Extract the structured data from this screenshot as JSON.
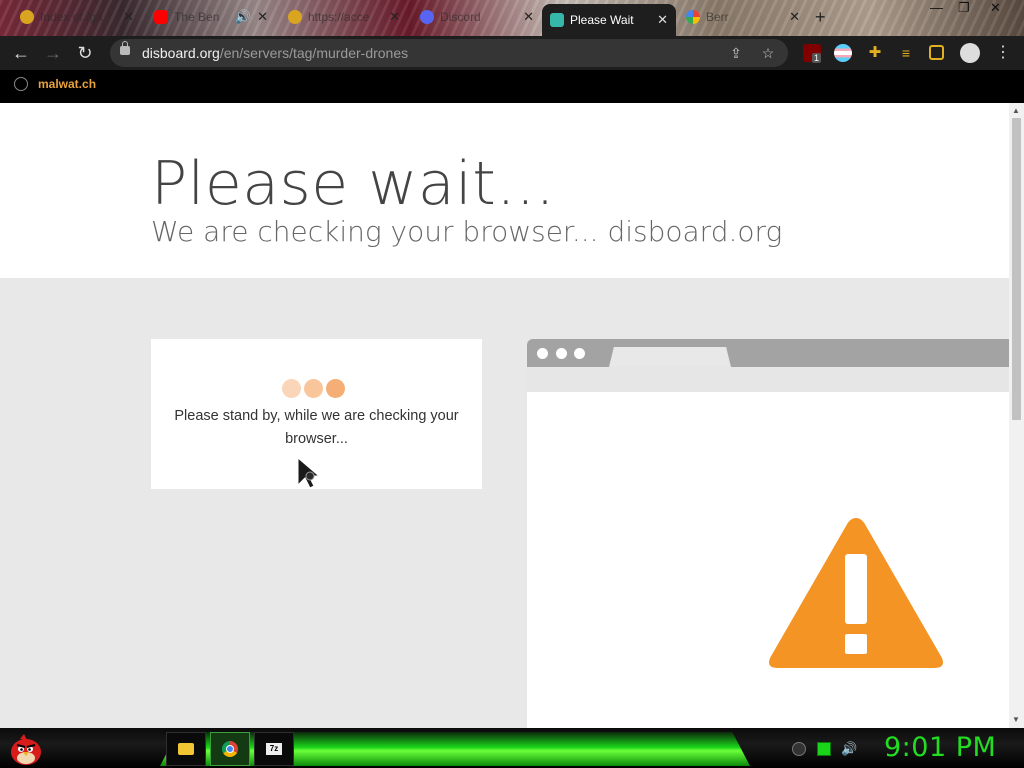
{
  "tabs": [
    {
      "title": "Index of /ga",
      "active": false,
      "favicon": "gold-coin-icon"
    },
    {
      "title": "The Ben",
      "active": false,
      "favicon": "youtube-icon"
    },
    {
      "title": "https://acce",
      "active": false,
      "favicon": "gold-coin-icon"
    },
    {
      "title": "Discord",
      "active": false,
      "favicon": "discord-icon"
    },
    {
      "title": "Please Wait",
      "active": true,
      "favicon": "disboard-icon"
    },
    {
      "title": "Berr",
      "active": false,
      "favicon": "google-icon"
    }
  ],
  "url": {
    "host": "disboard.org",
    "path": "/en/servers/tag/murder-drones"
  },
  "extensions": {
    "ublock_badge": "1"
  },
  "bookmarks": [
    {
      "label": "malwat.ch",
      "icon": "globe-icon"
    }
  ],
  "page": {
    "title": "Please wait...",
    "subtitle": "We are checking your browser... disboard.org",
    "card_message": "Please stand by, while we are checking your browser..."
  },
  "taskbar": {
    "clock": "9:01 PM",
    "apps": [
      "file-explorer-icon",
      "chrome-icon",
      "7zip-icon"
    ]
  },
  "colors": {
    "accent_orange": "#f39425",
    "clock_green": "#22dd22",
    "bookmark_text": "#e8a23a"
  }
}
